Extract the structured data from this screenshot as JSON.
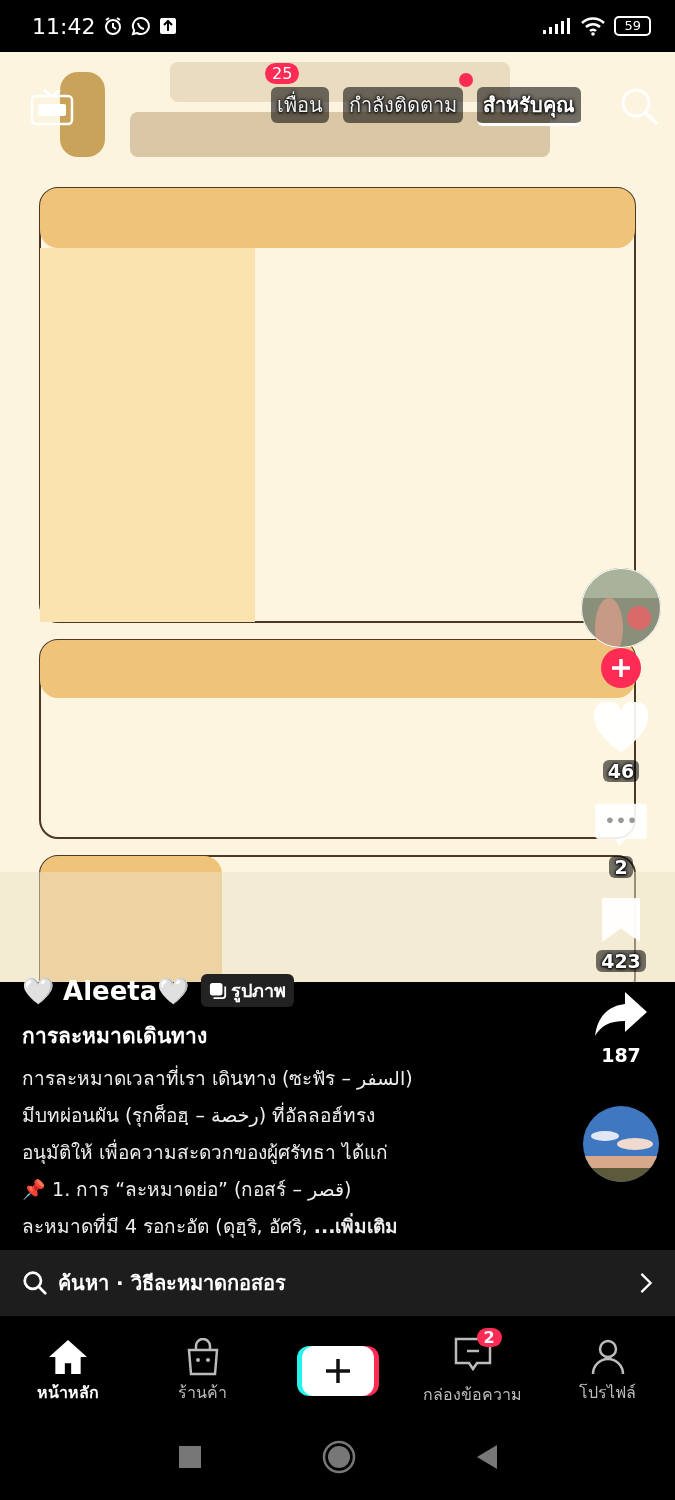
{
  "status_bar": {
    "time": "11:42",
    "battery": "59"
  },
  "top_tabs": [
    {
      "label": "เพื่อน",
      "badge": "25",
      "selected": false
    },
    {
      "label": "กำลังติดตาม",
      "dot": true,
      "selected": false
    },
    {
      "label": "สำหรับคุณ",
      "selected": true
    }
  ],
  "actions": {
    "likes": "46",
    "comments": "2",
    "saves": "423",
    "shares": "187"
  },
  "caption": {
    "author": "🤍 Aleeta🤍",
    "type_label": "รูปภาพ",
    "title": "การละหมาดเดินทาง",
    "lines": [
      "การละหมาดเวลาที่เรา เดินทาง (ซะฟัร – السفر)",
      "มีบทผ่อนผัน (รุกศ็อฮฺ – رخصة) ที่อัลลอฮ์ทรง",
      "อนุมัติให้ เพื่อความสะดวกของผู้ศรัทธา ได้แก่",
      "📌 1. การ “ละหมาดย่อ” (กอสร์ – قصر)",
      "ละหมาดที่มี 4 รอกะอัต (ดุฮฺริ, อัศริ, "
    ],
    "more": "...เพิ่มเติม"
  },
  "search_bar": {
    "text": "ค้นหา · วิธีละหมาดกอสอร"
  },
  "nav": [
    {
      "label": "หน้าหลัก",
      "kind": "home",
      "selected": true
    },
    {
      "label": "ร้านค้า",
      "kind": "shop",
      "selected": false
    },
    {
      "kind": "create"
    },
    {
      "label": "กล่องข้อความ",
      "kind": "inbox",
      "selected": false,
      "badge": "2"
    },
    {
      "label": "โปรไฟล์",
      "kind": "profile",
      "selected": false
    }
  ]
}
